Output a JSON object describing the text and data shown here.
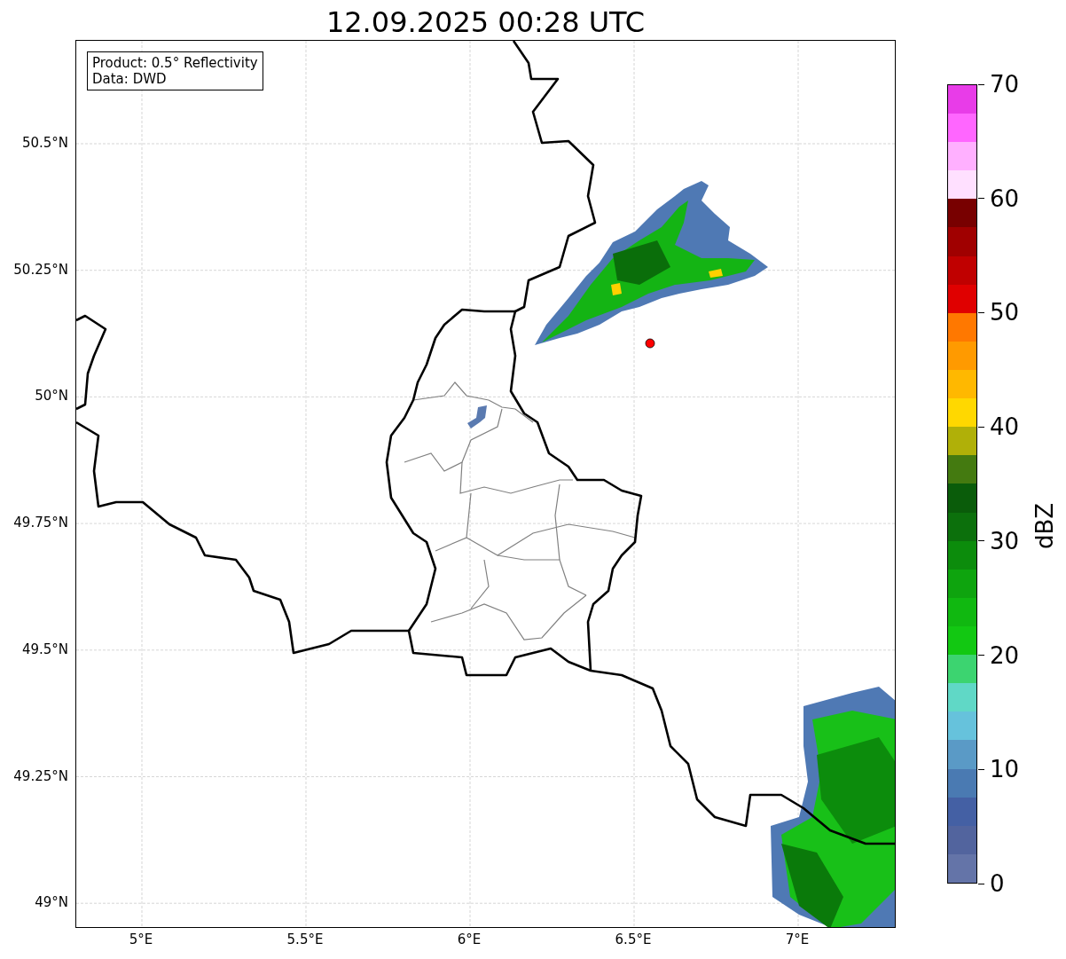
{
  "title": "12.09.2025 00:28 UTC",
  "info_box": {
    "lines": [
      "Product: 0.5° Reflectivity",
      "Data: DWD"
    ]
  },
  "map": {
    "lat_ticks": [
      "50.5°N",
      "50.25°N",
      "50°N",
      "49.75°N",
      "49.5°N",
      "49.25°N",
      "49°N"
    ],
    "lon_ticks": [
      "5°E",
      "5.5°E",
      "6°E",
      "6.5°E",
      "7°E"
    ]
  },
  "colorbar": {
    "label": "dBZ",
    "ticks": [
      "70",
      "60",
      "50",
      "40",
      "30",
      "20",
      "10",
      "0"
    ],
    "segments": [
      {
        "color": "#6474a8"
      },
      {
        "color": "#52649e"
      },
      {
        "color": "#4460a4"
      },
      {
        "color": "#4a7ab2"
      },
      {
        "color": "#5a9ac6"
      },
      {
        "color": "#66c2dc"
      },
      {
        "color": "#60d8c6"
      },
      {
        "color": "#3cd470"
      },
      {
        "color": "#12c812"
      },
      {
        "color": "#10b810"
      },
      {
        "color": "#0ea40e"
      },
      {
        "color": "#0c8c0c"
      },
      {
        "color": "#0c700c"
      },
      {
        "color": "#0a5c0a"
      },
      {
        "color": "#447a10"
      },
      {
        "color": "#b0b008"
      },
      {
        "color": "#ffd800"
      },
      {
        "color": "#ffb800"
      },
      {
        "color": "#ff9a00"
      },
      {
        "color": "#ff7800"
      },
      {
        "color": "#e00000"
      },
      {
        "color": "#c00000"
      },
      {
        "color": "#a00000"
      },
      {
        "color": "#780000"
      },
      {
        "color": "#ffe0ff"
      },
      {
        "color": "#ffb0ff"
      },
      {
        "color": "#ff66ff"
      },
      {
        "color": "#e83ce8"
      }
    ]
  }
}
